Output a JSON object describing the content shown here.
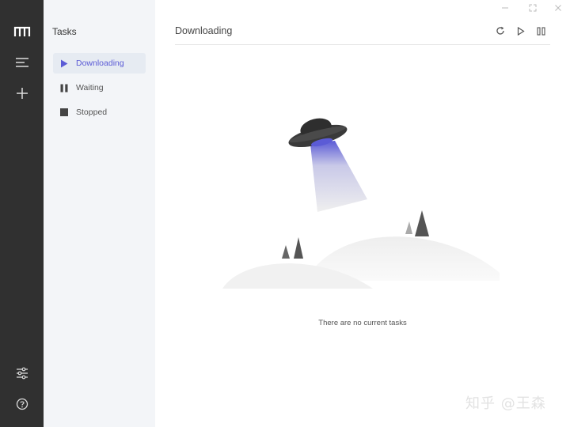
{
  "sidebar": {
    "title": "Tasks",
    "items": [
      {
        "label": "Downloading"
      },
      {
        "label": "Waiting"
      },
      {
        "label": "Stopped"
      }
    ]
  },
  "main": {
    "title": "Downloading",
    "empty_message": "There are no current tasks"
  },
  "watermark": "知乎 @王森",
  "colors": {
    "rail": "#303030",
    "sidebar": "#f3f5f8",
    "accent": "#5b5bd6",
    "active_item_bg": "#e6ebf2"
  }
}
